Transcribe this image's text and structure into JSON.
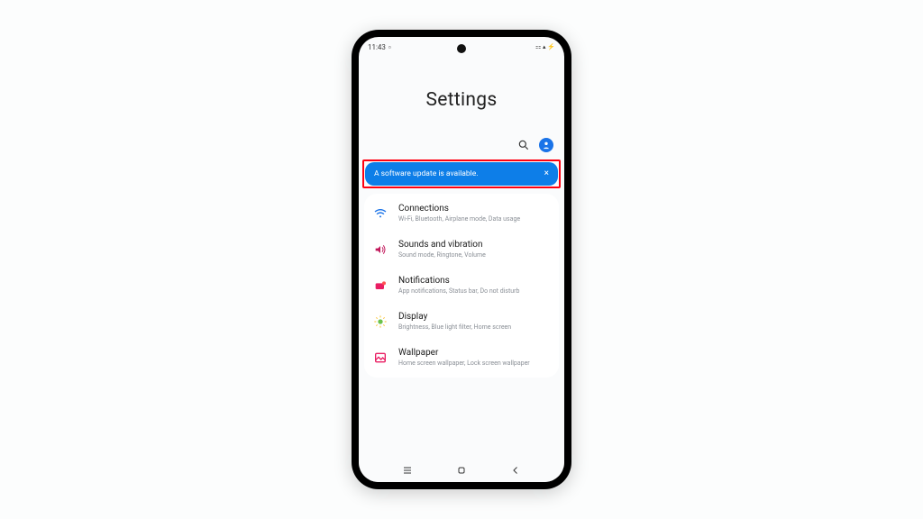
{
  "status": {
    "time": "11:43",
    "right": "⚏ ▴ ⚡"
  },
  "header": {
    "title": "Settings"
  },
  "banner": {
    "text": "A software update is available.",
    "close": "×"
  },
  "items": [
    {
      "title": "Connections",
      "sub": "Wi-Fi, Bluetooth, Airplane mode, Data usage"
    },
    {
      "title": "Sounds and vibration",
      "sub": "Sound mode, Ringtone, Volume"
    },
    {
      "title": "Notifications",
      "sub": "App notifications, Status bar, Do not disturb"
    },
    {
      "title": "Display",
      "sub": "Brightness, Blue light filter, Home screen"
    },
    {
      "title": "Wallpaper",
      "sub": "Home screen wallpaper, Lock screen wallpaper"
    }
  ]
}
